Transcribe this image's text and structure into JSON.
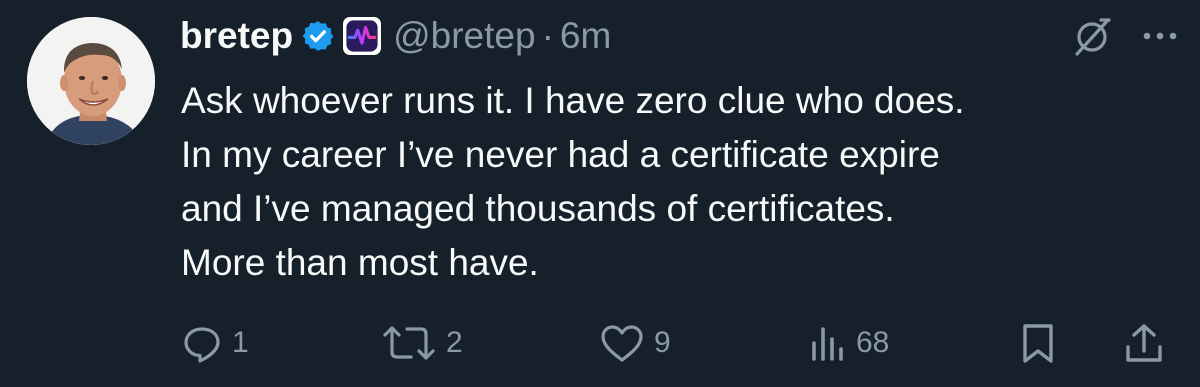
{
  "author": {
    "display_name": "bretep",
    "handle": "@bretep",
    "separator": "·",
    "time": "6m",
    "verified": true,
    "verified_color": "#1d9bf0",
    "affiliate_badge": "pulse-waveform-icon"
  },
  "tweet": {
    "lines": [
      "Ask whoever runs it. I have zero clue who does.",
      "In my career I’ve never had a certificate expire",
      "and I’ve managed thousands of certificates.",
      "More than most have."
    ]
  },
  "actions": {
    "replies": "1",
    "reposts": "2",
    "likes": "9",
    "views": "68"
  },
  "icons": {
    "top_right": [
      "grok-icon",
      "more-icon"
    ],
    "action_bar": [
      "reply-icon",
      "repost-icon",
      "like-icon",
      "views-icon",
      "bookmark-icon",
      "share-icon"
    ]
  },
  "colors": {
    "background": "#15202b",
    "text": "#f7f9f9",
    "muted": "#8b98a5"
  }
}
